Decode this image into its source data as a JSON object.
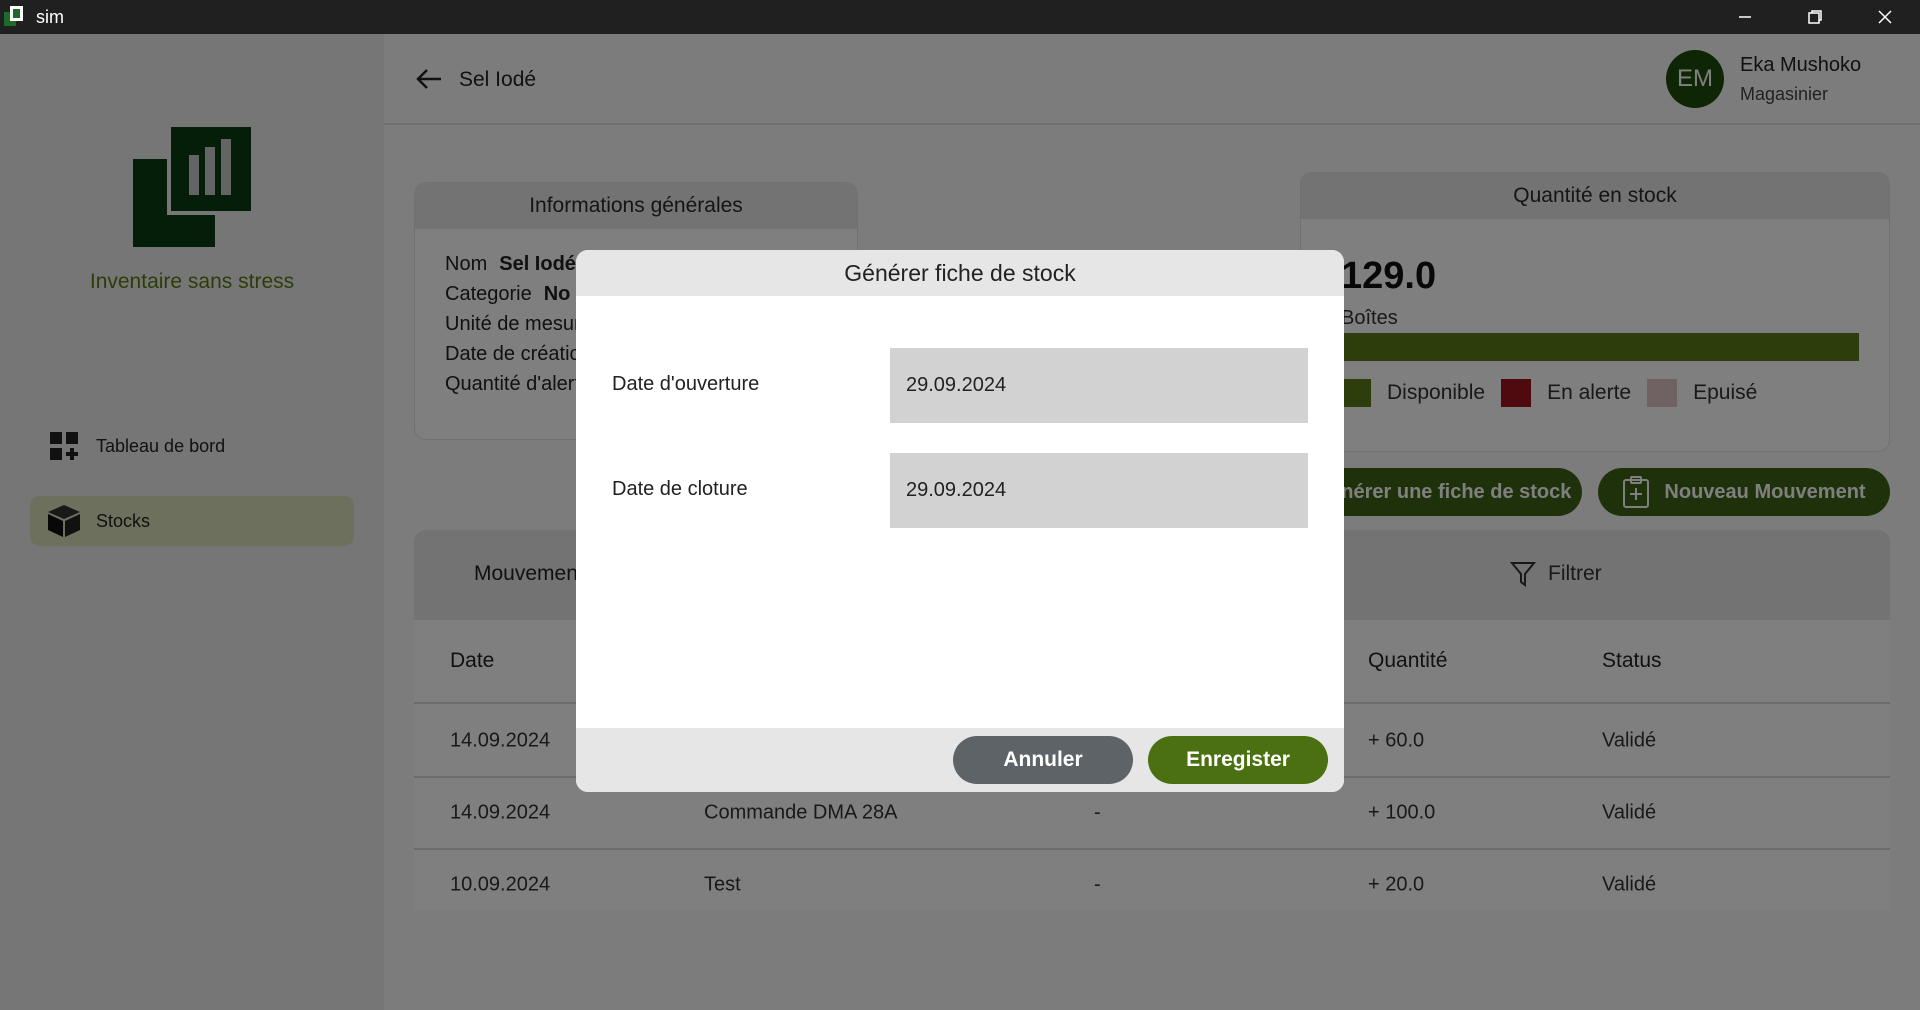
{
  "window": {
    "title": "sim"
  },
  "sidebar": {
    "brand": "Inventaire sans stress",
    "items": [
      {
        "label": "Tableau de bord",
        "icon": "dashboard-icon"
      },
      {
        "label": "Stocks",
        "icon": "cube-icon",
        "active": true
      }
    ]
  },
  "header": {
    "title": "Sel Iodé",
    "user": {
      "initials": "EM",
      "name": "Eka Mushoko",
      "role": "Magasinier"
    }
  },
  "info_card": {
    "title": "Informations générales",
    "rows": [
      {
        "label": "Nom",
        "value": "Sel Iodé"
      },
      {
        "label": "Categorie",
        "value": "No"
      },
      {
        "label": "Unité de mesure",
        "value": ""
      },
      {
        "label": "Date de création",
        "value": ""
      },
      {
        "label": "Quantité d'alerte",
        "value": ""
      }
    ]
  },
  "stock_card": {
    "title": "Quantité en stock",
    "quantity": "129.0",
    "unit": "Boîtes",
    "legend": [
      {
        "label": "Disponible",
        "color": "#5b7b16"
      },
      {
        "label": "En alerte",
        "color": "#9e1520"
      },
      {
        "label": "Epuisé",
        "color": "#e0c5c5"
      }
    ]
  },
  "actions": {
    "generate_label": "Générer une fiche de stock",
    "new_movement_label": "Nouveau Mouvement"
  },
  "table": {
    "tab_label": "Mouvements",
    "filter_label": "Filtrer",
    "headers": [
      "Date",
      "",
      "",
      "Quantité",
      "Status"
    ],
    "rows": [
      {
        "date": "14.09.2024",
        "label": "",
        "ref": "",
        "qty": "+ 60.0",
        "status": "Validé"
      },
      {
        "date": "14.09.2024",
        "label": "Commande DMA 28A",
        "ref": "-",
        "qty": "+ 100.0",
        "status": "Validé"
      },
      {
        "date": "10.09.2024",
        "label": "Test",
        "ref": "-",
        "qty": "+ 20.0",
        "status": "Validé"
      }
    ]
  },
  "modal": {
    "title": "Générer fiche de stock",
    "open_label": "Date d'ouverture",
    "open_value": "29.09.2024",
    "close_label": "Date de cloture",
    "close_value": "29.09.2024",
    "cancel_label": "Annuler",
    "save_label": "Enregister"
  },
  "colors": {
    "brand": "#0a3d12",
    "accent": "#4a7011",
    "cancel": "#5e6367"
  }
}
